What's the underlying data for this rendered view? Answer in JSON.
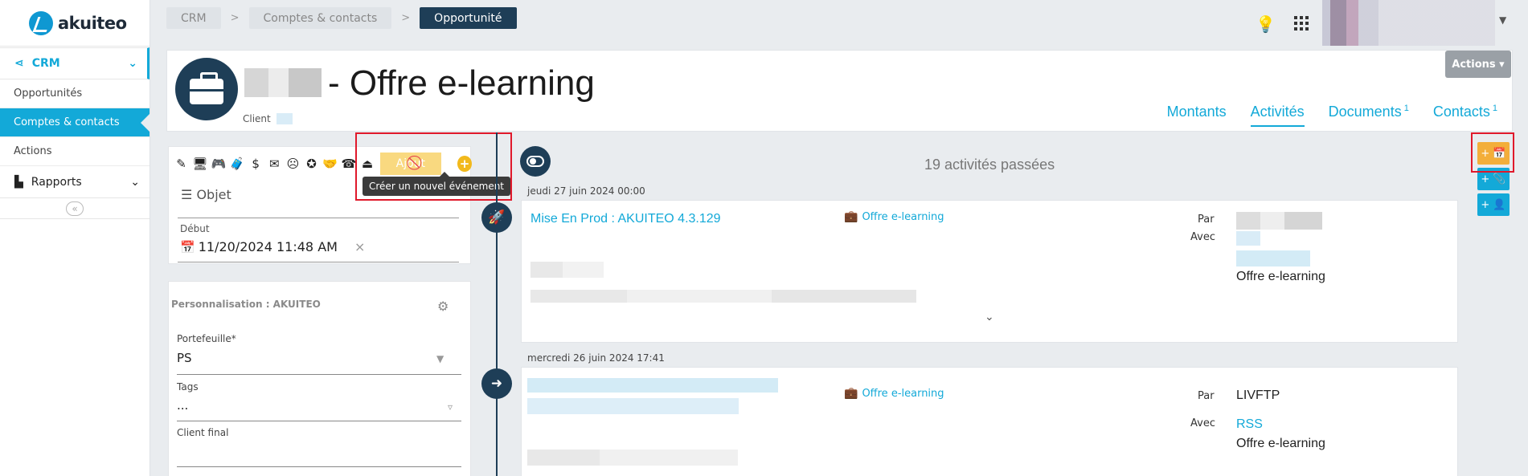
{
  "brand": {
    "name": "akuiteo"
  },
  "sidebar": {
    "crm_label": "CRM",
    "items": [
      {
        "label": "Opportunités",
        "active": false
      },
      {
        "label": "Comptes & contacts",
        "active": true
      },
      {
        "label": "Actions",
        "active": false
      }
    ],
    "rapports_label": "Rapports"
  },
  "breadcrumb": {
    "items": [
      "CRM",
      "Comptes & contacts",
      "Opportunité"
    ],
    "separator": ">"
  },
  "header": {
    "title": "- Offre e-learning",
    "client_label": "Client",
    "actions_label": "Actions ▾",
    "tabs": [
      {
        "label": "Montants",
        "badge": ""
      },
      {
        "label": "Activités",
        "badge": "",
        "active": true
      },
      {
        "label": "Documents",
        "badge": "1"
      },
      {
        "label": "Contacts",
        "badge": "1"
      }
    ]
  },
  "form": {
    "ajout_label": "Ajout",
    "tooltip": "Créer un nouvel événement",
    "objet_label": "Objet",
    "debut_label": "Début",
    "debut_value": "11/20/2024 11:48 AM",
    "clear_symbol": "×",
    "perso_title": "Personnalisation : AKUITEO",
    "portefeuille_label": "Portefeuille*",
    "portefeuille_value": "PS",
    "tags_label": "Tags",
    "tags_value": "...",
    "client_final_label": "Client final"
  },
  "timeline": {
    "past_count": "19 activités passées",
    "activities": [
      {
        "date": "jeudi 27 juin 2024 00:00",
        "title": "Mise En Prod : AKUITEO 4.3.129",
        "opportunity": "Offre e-learning",
        "par_label": "Par",
        "avec_label": "Avec",
        "avec_extra": "Offre e-learning"
      },
      {
        "date": "mercredi 26 juin 2024 17:41",
        "opportunity": "Offre e-learning",
        "par_label": "Par",
        "par_value": "LIVFTP",
        "avec_label": "Avec",
        "avec_value": "RSS",
        "avec_extra": "Offre e-learning"
      }
    ]
  },
  "colors": {
    "accent": "#13a9d8",
    "navy": "#1e3e57",
    "yellow": "#f2b91c",
    "highlight_red": "#e0192b"
  }
}
